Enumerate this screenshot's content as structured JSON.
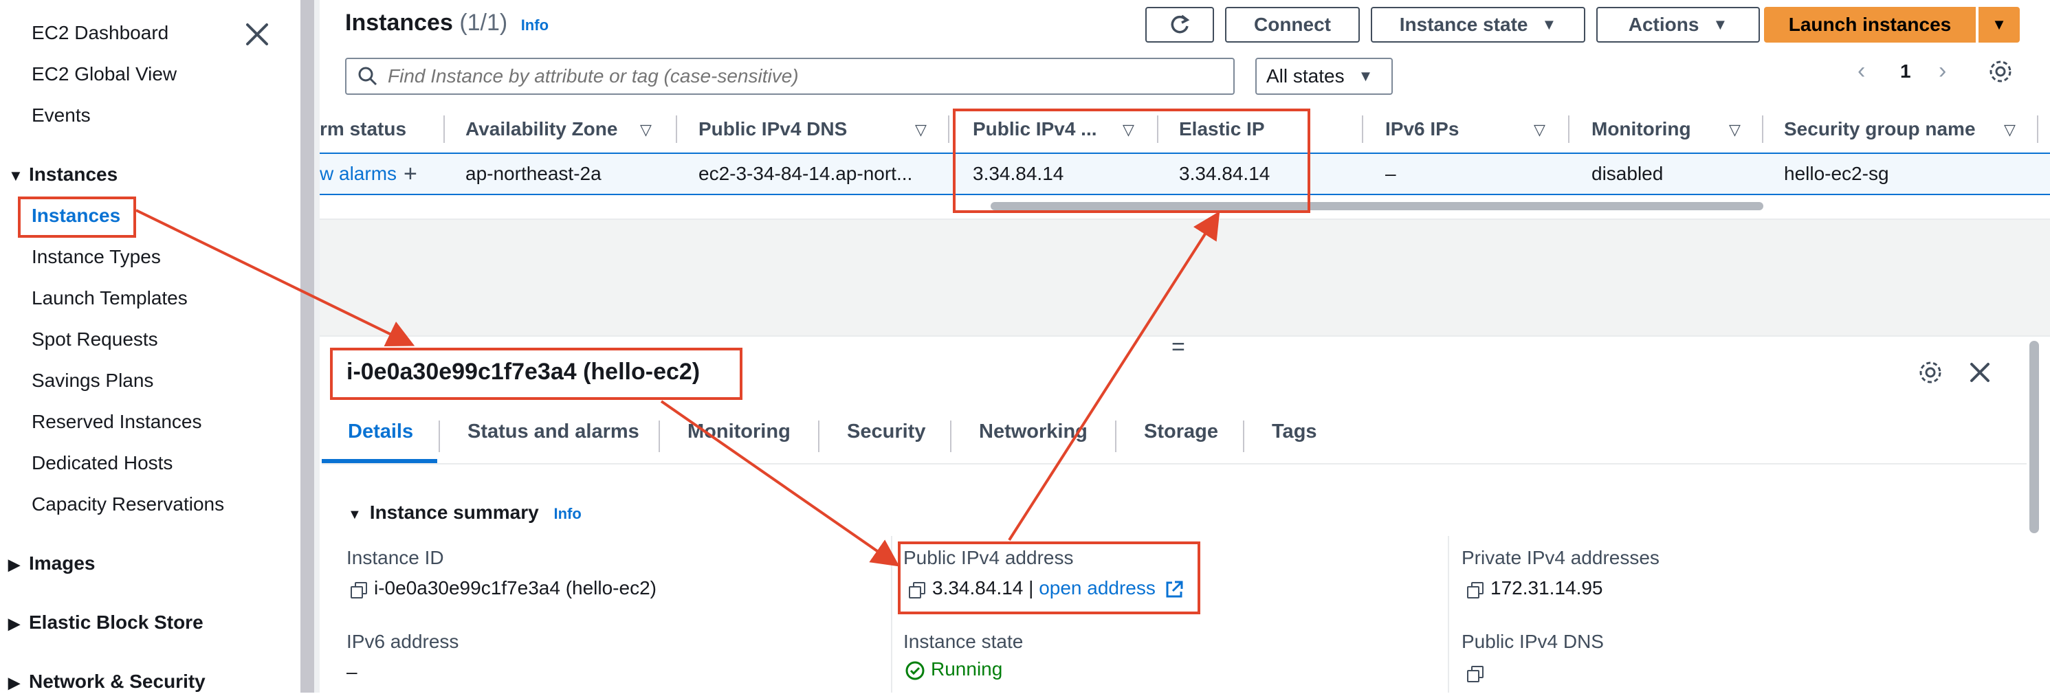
{
  "sidebar": {
    "links_top": [
      "EC2 Dashboard",
      "EC2 Global View",
      "Events"
    ],
    "instances_section": "Instances",
    "instances_links": [
      "Instances",
      "Instance Types",
      "Launch Templates",
      "Spot Requests",
      "Savings Plans",
      "Reserved Instances",
      "Dedicated Hosts",
      "Capacity Reservations"
    ],
    "collapsed_sections": [
      "Images",
      "Elastic Block Store",
      "Network & Security"
    ]
  },
  "header": {
    "title": "Instances",
    "count": "(1/1)",
    "info": "Info",
    "connect": "Connect",
    "instance_state": "Instance state",
    "actions": "Actions",
    "launch": "Launch instances"
  },
  "search": {
    "placeholder": "Find Instance by attribute or tag (case-sensitive)",
    "states": "All states"
  },
  "pagination": {
    "page": "1"
  },
  "table": {
    "columns": [
      "rm status",
      "Availability Zone",
      "Public IPv4 DNS",
      "Public IPv4 ...",
      "Elastic IP",
      "IPv6 IPs",
      "Monitoring",
      "Security group name"
    ],
    "row": [
      "w alarms",
      "ap-northeast-2a",
      "ec2-3-34-84-14.ap-nort...",
      "3.34.84.14",
      "3.34.84.14",
      "–",
      "disabled",
      "hello-ec2-sg"
    ]
  },
  "detail": {
    "title": "i-0e0a30e99c1f7e3a4 (hello-ec2)",
    "tabs": [
      "Details",
      "Status and alarms",
      "Monitoring",
      "Security",
      "Networking",
      "Storage",
      "Tags"
    ],
    "summary_heading": "Instance summary",
    "summary_info": "Info",
    "instance_id_label": "Instance ID",
    "instance_id_value": "i-0e0a30e99c1f7e3a4 (hello-ec2)",
    "public_ipv4_label": "Public IPv4 address",
    "public_ipv4_value": "3.34.84.14",
    "public_ipv4_sep": "|",
    "open_address": "open address",
    "private_ipv4_label": "Private IPv4 addresses",
    "private_ipv4_value": "172.31.14.95",
    "ipv6_label": "IPv6 address",
    "ipv6_value": "–",
    "state_label": "Instance state",
    "state_value": "Running",
    "public_dns_label": "Public IPv4 DNS"
  },
  "colors": {
    "accent": "#0972d3",
    "primary_button": "#f0963b",
    "annotation": "#e2452b",
    "running": "#037f0c"
  }
}
